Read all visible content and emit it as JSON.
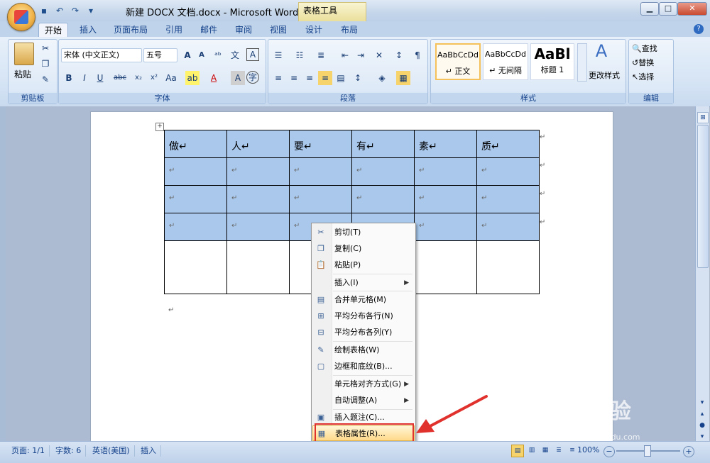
{
  "window": {
    "title": "新建 DOCX 文档.docx - Microsoft Word",
    "context_group": "表格工具",
    "controls": [
      "▁",
      "□",
      "✕"
    ]
  },
  "qat": [
    "save-icon",
    "undo-icon",
    "redo-icon",
    "customize-icon"
  ],
  "tabs": [
    "开始",
    "插入",
    "页面布局",
    "引用",
    "邮件",
    "审阅",
    "视图",
    "设计",
    "布局"
  ],
  "active_tab": "开始",
  "ribbon": {
    "clipboard": {
      "label": "剪贴板",
      "paste": "粘贴"
    },
    "font": {
      "label": "字体",
      "font_name": "宋体 (中文正文)",
      "font_size": "五号"
    },
    "paragraph": {
      "label": "段落"
    },
    "styles": {
      "label": "样式",
      "items": [
        {
          "preview": "AaBbCcDd",
          "name": "↵ 正文"
        },
        {
          "preview": "AaBbCcDd",
          "name": "↵ 无间隔"
        },
        {
          "preview": "AaBl",
          "name": "标题 1"
        }
      ],
      "change": "更改样式"
    },
    "editing": {
      "label": "编辑",
      "find": "查找",
      "replace": "替换",
      "select": "选择"
    }
  },
  "table": {
    "header": [
      "做↵",
      "人↵",
      "要↵",
      "有↵",
      "素↵",
      "质↵"
    ],
    "empty_cell": "↵"
  },
  "context_menu": [
    {
      "icon": "cut-icon",
      "label": "剪切(T)"
    },
    {
      "icon": "copy-icon",
      "label": "复制(C)"
    },
    {
      "icon": "paste-icon",
      "label": "粘贴(P)"
    },
    {
      "icon": "",
      "label": "插入(I)",
      "submenu": true
    },
    {
      "icon": "merge-icon",
      "label": "合并单元格(M)"
    },
    {
      "icon": "distribute-rows-icon",
      "label": "平均分布各行(N)"
    },
    {
      "icon": "distribute-cols-icon",
      "label": "平均分布各列(Y)"
    },
    {
      "icon": "draw-table-icon",
      "label": "绘制表格(W)"
    },
    {
      "icon": "borders-icon",
      "label": "边框和底纹(B)..."
    },
    {
      "icon": "",
      "label": "单元格对齐方式(G)",
      "submenu": true
    },
    {
      "icon": "",
      "label": "自动调整(A)",
      "submenu": true
    },
    {
      "icon": "caption-icon",
      "label": "插入题注(C)..."
    },
    {
      "icon": "table-properties-icon",
      "label": "表格属性(R)..."
    }
  ],
  "status": {
    "page": "页面: 1/1",
    "words": "字数: 6",
    "language": "英语(美国)",
    "mode": "插入",
    "zoom": "100%"
  },
  "watermark": {
    "main": "Bai 经验",
    "sub": "jingyan.baidu.com"
  }
}
